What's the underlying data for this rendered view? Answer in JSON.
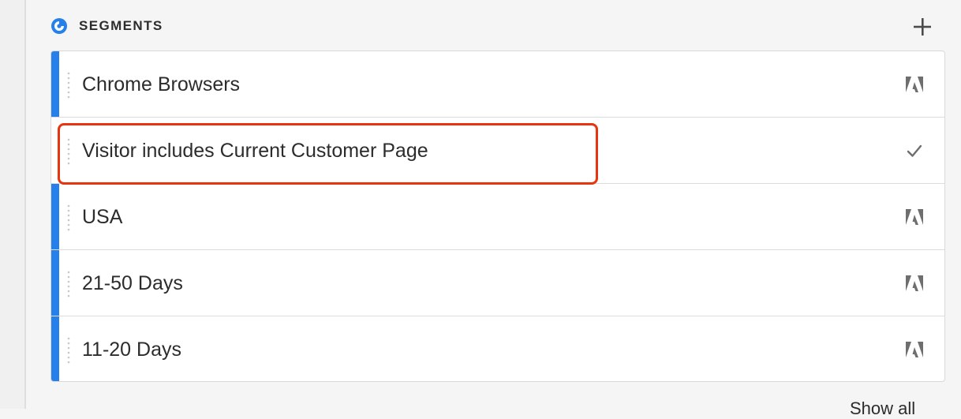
{
  "colors": {
    "accent": "#2680eb",
    "annotation": "#e8340f"
  },
  "header": {
    "title": "SEGMENTS",
    "icon": "segments-icon",
    "add_icon": "plus-icon"
  },
  "segments": [
    {
      "label": "Chrome Browsers",
      "icon": "adobe-logo-icon",
      "accent": true
    },
    {
      "label": "Visitor includes Current Customer Page",
      "icon": "checkmark-icon",
      "accent": false,
      "highlighted": true
    },
    {
      "label": "USA",
      "icon": "adobe-logo-icon",
      "accent": true
    },
    {
      "label": "21-50 Days",
      "icon": "adobe-logo-icon",
      "accent": true
    },
    {
      "label": "11-20 Days",
      "icon": "adobe-logo-icon",
      "accent": true
    }
  ],
  "footer": {
    "link_text": "Show all"
  }
}
